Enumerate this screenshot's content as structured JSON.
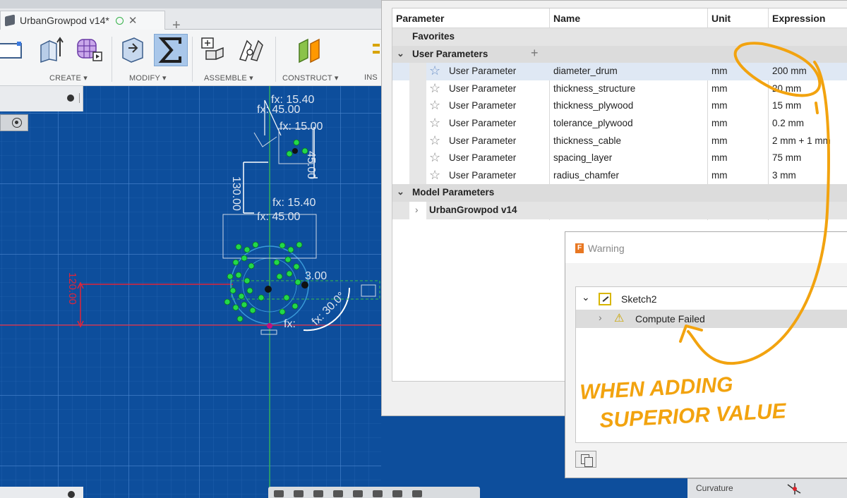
{
  "tab": {
    "title": "UrbanGrowpod v14*",
    "close": "✕",
    "new": "+"
  },
  "toolbar": {
    "groups": [
      {
        "label": "CREATE ▾"
      },
      {
        "label": "MODIFY ▾"
      },
      {
        "label": "ASSEMBLE ▾"
      },
      {
        "label": "CONSTRUCT ▾"
      },
      {
        "label": "INS"
      }
    ]
  },
  "sketch": {
    "dims": [
      "fx: 15.40",
      "fx: 45.00",
      "fx: 15.00",
      "130.00",
      "45.00",
      "fx: 15.40",
      "fx: 45.00",
      "3.00",
      "120.00",
      "fx: 30.0°",
      "fx:"
    ],
    "colors": {
      "background": "#0d4e9c",
      "grid": "#2c6ab5",
      "constraint": "#22d84a",
      "dimension_red": "#e0243a"
    }
  },
  "parameters": {
    "columns": [
      "Parameter",
      "Name",
      "Unit",
      "Expression"
    ],
    "favorites_label": "Favorites",
    "user_group_label": "User Parameters",
    "user_rows": [
      {
        "param": "User Parameter",
        "name": "diameter_drum",
        "unit": "mm",
        "expr": "200 mm"
      },
      {
        "param": "User Parameter",
        "name": "thickness_structure",
        "unit": "mm",
        "expr": "20 mm"
      },
      {
        "param": "User Parameter",
        "name": "thickness_plywood",
        "unit": "mm",
        "expr": "15 mm"
      },
      {
        "param": "User Parameter",
        "name": "tolerance_plywood",
        "unit": "mm",
        "expr": "0.2 mm"
      },
      {
        "param": "User Parameter",
        "name": "thickness_cable",
        "unit": "mm",
        "expr": "2 mm + 1 mm"
      },
      {
        "param": "User Parameter",
        "name": "spacing_layer",
        "unit": "mm",
        "expr": "75 mm"
      },
      {
        "param": "User Parameter",
        "name": "radius_chamfer",
        "unit": "mm",
        "expr": "3 mm"
      }
    ],
    "model_group_label": "Model Parameters",
    "model_child": "UrbanGrowpod v14"
  },
  "warning": {
    "title": "Warning",
    "sketch": "Sketch2",
    "message": "Compute Failed"
  },
  "annotation": {
    "line1": "WHEN ADDING",
    "line2": "SUPERIOR VALUE",
    "color": "#f2a30f"
  },
  "bottom": {
    "curvature": "Curvature"
  }
}
